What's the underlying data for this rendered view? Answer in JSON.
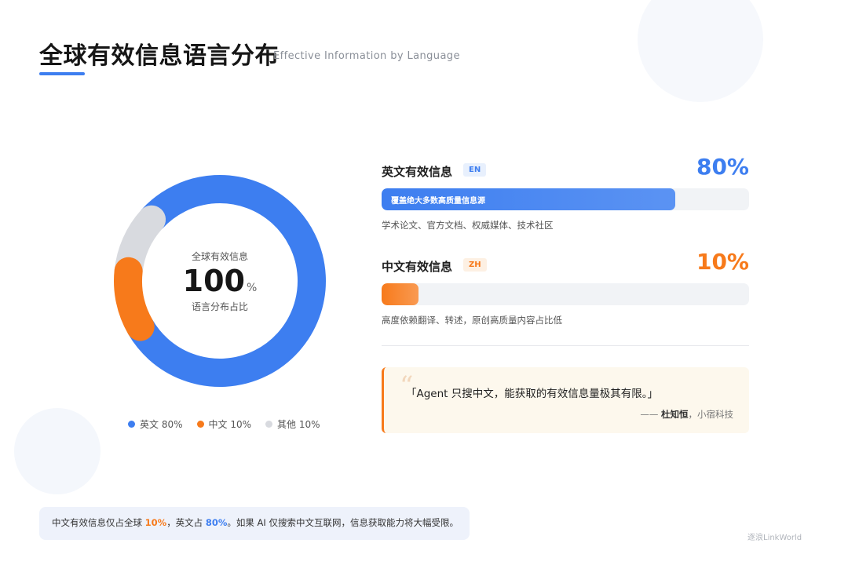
{
  "header": {
    "title": "全球有效信息语言分布",
    "subtitle": "Effective Information by Language"
  },
  "donut": {
    "center_top": "全球有效信息",
    "center_value": "100",
    "center_unit": "%",
    "center_bottom": "语言分布占比"
  },
  "chart_data": {
    "type": "pie",
    "categories": [
      "英文",
      "中文",
      "其他"
    ],
    "values": [
      80,
      10,
      10
    ],
    "colors": [
      "#3d7ef0",
      "#f77a1b",
      "#d8dadf"
    ],
    "legend": [
      "英文 80%",
      "中文 10%",
      "其他 10%"
    ],
    "legend_placement": "bottom"
  },
  "metrics": [
    {
      "label": "英文有效信息",
      "tag": "EN",
      "value_text": "80%",
      "value": 0.8,
      "bar_text": "覆盖绝大多数高质量信息源",
      "desc": "学术论文、官方文档、权威媒体、技术社区",
      "color": "#3d7ef0"
    },
    {
      "label": "中文有效信息",
      "tag": "ZH",
      "value_text": "10%",
      "value": 0.1,
      "bar_text": "",
      "desc": "高度依赖翻译、转述，原创高质量内容占比低",
      "color": "#f77a1b"
    }
  ],
  "quote": {
    "mark": "“",
    "text": "「Agent 只搜中文，能获取的有效信息量极其有限。」",
    "author_prefix": "—— ",
    "author_name": "杜知恒",
    "author_suffix": "，小宿科技"
  },
  "summary": {
    "part1": "中文有效信息仅占全球 ",
    "hl1": "10%",
    "part2": "，英文占 ",
    "hl2": "80%",
    "part3": "。如果 AI 仅搜索中文互联网，信息获取能力将大幅受限。"
  },
  "watermark": "逐浪LinkWorld"
}
